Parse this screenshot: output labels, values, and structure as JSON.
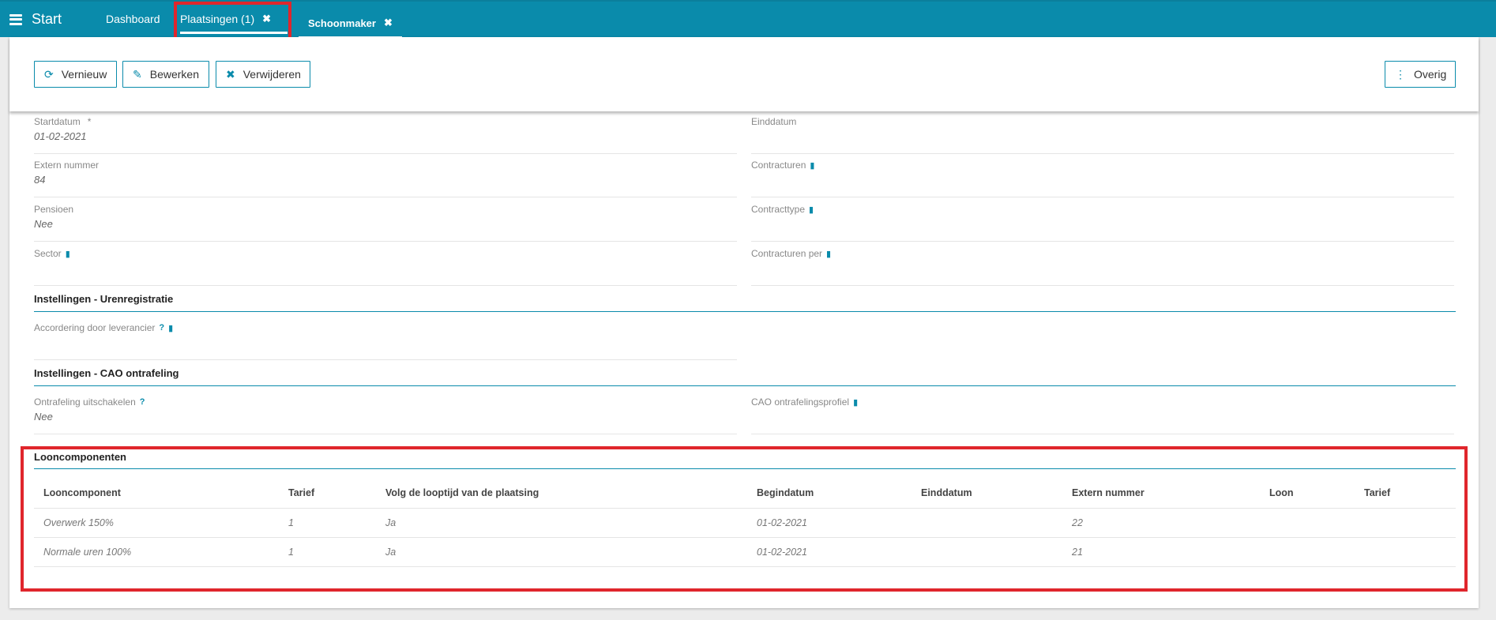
{
  "topbar": {
    "brand": "Start",
    "tabs": [
      {
        "label": "Dashboard"
      },
      {
        "label": "Plaatsingen (1)",
        "close": "✖"
      },
      {
        "label": "Schoonmaker",
        "close": "✖"
      }
    ]
  },
  "toolbar": {
    "refresh": "Vernieuw",
    "edit": "Bewerken",
    "delete": "Verwijderen",
    "other": "Overig"
  },
  "fields": {
    "startdatum": {
      "label": "Startdatum",
      "required": "*",
      "value": "01-02-2021"
    },
    "einddatum": {
      "label": "Einddatum",
      "value": ""
    },
    "extern_nummer": {
      "label": "Extern nummer",
      "value": "84"
    },
    "contracturen": {
      "label": "Contracturen",
      "value": ""
    },
    "pensioen": {
      "label": "Pensioen",
      "value": "Nee"
    },
    "contracttype": {
      "label": "Contracttype",
      "value": ""
    },
    "sector": {
      "label": "Sector",
      "value": ""
    },
    "contracturen_per": {
      "label": "Contracturen per",
      "value": ""
    },
    "accordering": {
      "label": "Accordering door leverancier",
      "value": ""
    },
    "ontrafeling": {
      "label": "Ontrafeling uitschakelen",
      "value": "Nee"
    },
    "cao_profiel": {
      "label": "CAO ontrafelingsprofiel",
      "value": ""
    }
  },
  "sections": {
    "urenregistratie": "Instellingen - Urenregistratie",
    "cao": "Instellingen - CAO ontrafeling",
    "looncomponenten": "Looncomponenten"
  },
  "table": {
    "headers": [
      "Looncomponent",
      "Tarief",
      "Volg de looptijd van de plaatsing",
      "Begindatum",
      "Einddatum",
      "Extern nummer",
      "Loon",
      "Tarief"
    ],
    "rows": [
      [
        "Overwerk 150%",
        "1",
        "Ja",
        "01-02-2021",
        "",
        "22",
        "",
        ""
      ],
      [
        "Normale uren 100%",
        "1",
        "Ja",
        "01-02-2021",
        "",
        "21",
        "",
        ""
      ]
    ]
  },
  "colors": {
    "accent": "#0a8bab",
    "highlight": "#e0262c"
  }
}
